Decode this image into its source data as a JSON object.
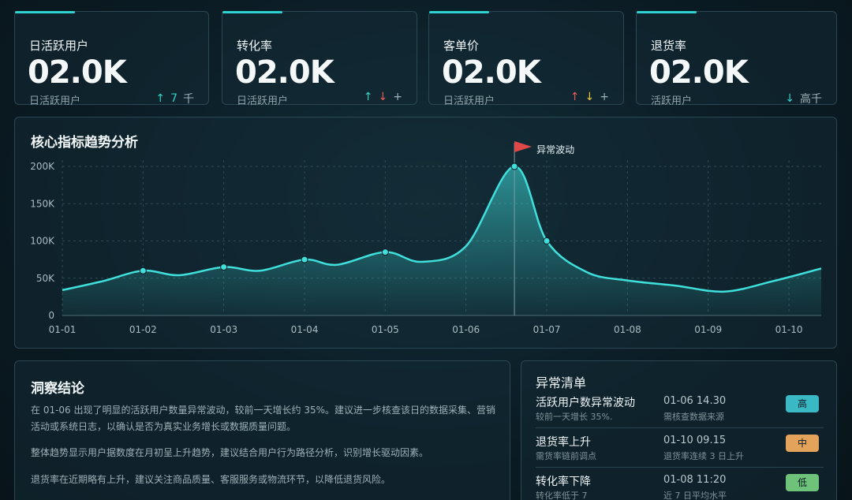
{
  "kpis": [
    {
      "title": "日活跃用户",
      "value": "02.0K",
      "sub": "日活跃用户",
      "trend": [
        {
          "sym": "↑",
          "cls": "up-c"
        },
        {
          "sym": "7",
          "cls": "up-c"
        },
        {
          "sym": "千",
          "cls": "neutral"
        }
      ]
    },
    {
      "title": "转化率",
      "value": "02.0K",
      "sub": "日活跃用户",
      "trend": [
        {
          "sym": "↑",
          "cls": "up-c"
        },
        {
          "sym": "↓",
          "cls": "up-r"
        },
        {
          "sym": "+",
          "cls": "neutral"
        }
      ]
    },
    {
      "title": "客单价",
      "value": "02.0K",
      "sub": "日活跃用户",
      "trend": [
        {
          "sym": "↑",
          "cls": "up-r"
        },
        {
          "sym": "↓",
          "cls": "down-y"
        },
        {
          "sym": "+",
          "cls": "neutral"
        }
      ]
    },
    {
      "title": "退货率",
      "value": "02.0K",
      "sub": "活跃用户",
      "trend": [
        {
          "sym": "↓",
          "cls": "down-c"
        },
        {
          "sym": "高千",
          "cls": "neutral"
        }
      ]
    }
  ],
  "chart": {
    "title": "核心指标趋势分析",
    "flag_label": "异常波动"
  },
  "chart_data": {
    "type": "area",
    "title": "核心指标趋势分析",
    "x_ticks": [
      "01-01",
      "01-02",
      "01-03",
      "01-04",
      "01-05",
      "01-06",
      "01-07",
      "01-08",
      "01-09",
      "01-10"
    ],
    "y_ticks": [
      "0",
      "50K",
      "100K",
      "150K",
      "200K"
    ],
    "ylim": [
      0,
      200000
    ],
    "grid": true,
    "series": [
      {
        "x": [
          0,
          0.5,
          1,
          1.45,
          2,
          2.45,
          3,
          3.4,
          4,
          4.45,
          5,
          5.6,
          6,
          6.5,
          7,
          7.6,
          8.2,
          8.8,
          9.4
        ],
        "values": [
          34000,
          46000,
          60000,
          54000,
          65000,
          60000,
          75000,
          68000,
          85000,
          72000,
          93000,
          200000,
          100000,
          58000,
          47000,
          40000,
          32000,
          46000,
          63000
        ]
      }
    ],
    "markers_x": [
      1,
      2,
      3,
      4,
      5.6,
      6
    ],
    "annotation": {
      "x": 5.6,
      "label": "异常波动"
    },
    "color": "#3fe0dc"
  },
  "insight": {
    "title": "洞察结论",
    "p1": "在 01-06 出现了明显的活跃用户数量异常波动，较前一天增长约 35%。建议进一步核查该日的数据采集、营销活动或系统日志，以确认是否为真实业务增长或数据质量问题。",
    "p2": "整体趋势显示用户据数度在月初呈上升趋势，建议结合用户行为路径分析，识别增长驱动因素。",
    "p3": "退货率在近期略有上升，建议关注商品质量、客服服务或物流环节，以降低退货风险。"
  },
  "anomalies": {
    "title": "异常清单",
    "items": [
      {
        "name": "活跃用户数异常波动",
        "desc": "较前一天增长 35%.",
        "time": "01-06 14.30",
        "tdesc": "需核查数据来源",
        "badge": "高",
        "color": "#3ab8c4"
      },
      {
        "name": "退货率上升",
        "desc": "需货率链前调点",
        "time": "01-10 09.15",
        "tdesc": "退货率连续 3 日上升",
        "badge": "中",
        "color": "#e3a35a"
      },
      {
        "name": "转化率下降",
        "desc": "转化率低于 7",
        "time": "01-08 11:20",
        "tdesc": "近 7 日平均水平",
        "badge": "低",
        "color": "#6ec27a"
      }
    ]
  }
}
